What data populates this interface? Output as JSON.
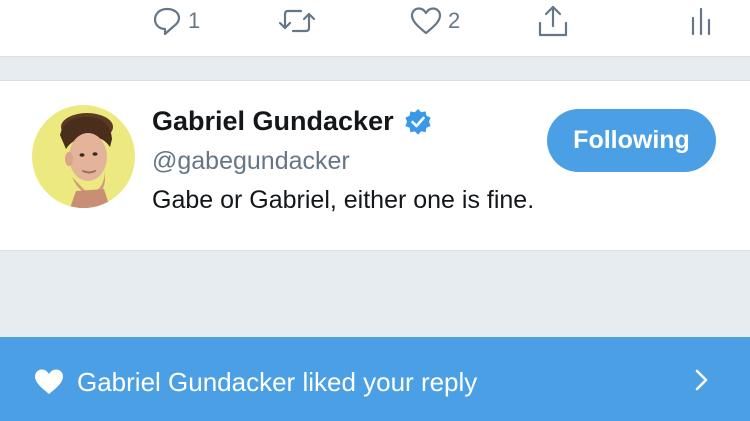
{
  "actions": {
    "reply_count": "1",
    "like_count": "2"
  },
  "profile": {
    "name": "Gabriel Gundacker",
    "handle": "@gabegundacker",
    "bio": "Gabe or Gabriel, either one is fine.",
    "verified": true,
    "follow_label": "Following"
  },
  "notification": {
    "text": "Gabriel Gundacker liked your reply"
  },
  "colors": {
    "accent": "#4b9fe4",
    "verified_badge": "#3a98e8",
    "avatar_bg": "#ece981",
    "muted_icon": "#657786"
  }
}
